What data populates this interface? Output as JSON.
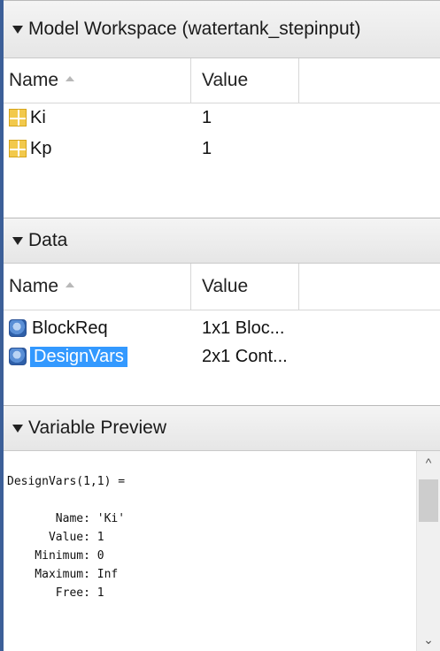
{
  "model_workspace": {
    "title": "Model Workspace (watertank_stepinput)",
    "columns": {
      "name": "Name",
      "value": "Value"
    },
    "rows": [
      {
        "name": "Ki",
        "value": "1",
        "icon": "matrix-icon"
      },
      {
        "name": "Kp",
        "value": "1",
        "icon": "matrix-icon"
      }
    ]
  },
  "data_section": {
    "title": "Data",
    "columns": {
      "name": "Name",
      "value": "Value"
    },
    "rows": [
      {
        "name": "BlockReq",
        "value": "1x1 Bloc...",
        "icon": "object-icon"
      },
      {
        "name": "DesignVars",
        "value": "2x1 Cont...",
        "icon": "object-icon",
        "selected": true
      }
    ]
  },
  "variable_preview": {
    "title": "Variable Preview",
    "text": "DesignVars(1,1) =\n\n       Name: 'Ki'\n      Value: 1\n    Minimum: 0\n    Maximum: Inf\n       Free: 1"
  },
  "colors": {
    "selection": "#3399ff",
    "frame_accent": "#3c5f98"
  }
}
